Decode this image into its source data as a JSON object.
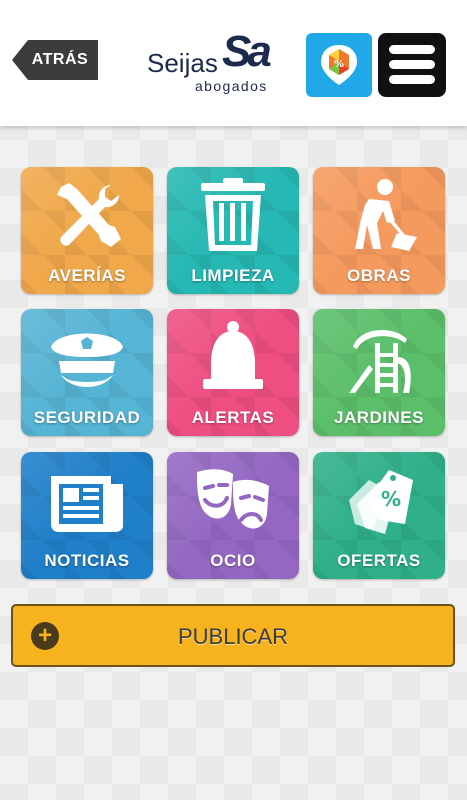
{
  "header": {
    "back_label": "ATRÁS",
    "logo": {
      "name": "Seijas",
      "mark": "Sa",
      "sub": "abogados"
    },
    "app_icon": "offers-app-icon",
    "menu_icon": "hamburger-menu-icon"
  },
  "tiles": [
    {
      "label": "AVERÍAS",
      "icon": "tools-icon",
      "color": "#f0a84a"
    },
    {
      "label": "LIMPIEZA",
      "icon": "trash-can-icon",
      "color": "#26b8b3"
    },
    {
      "label": "OBRAS",
      "icon": "construction-worker-icon",
      "color": "#f59a5e"
    },
    {
      "label": "SEGURIDAD",
      "icon": "police-cap-icon",
      "color": "#56b4d4"
    },
    {
      "label": "ALERTAS",
      "icon": "bell-icon",
      "color": "#ee4f80"
    },
    {
      "label": "JARDINES",
      "icon": "playground-icon",
      "color": "#5bbf6a"
    },
    {
      "label": "NOTICIAS",
      "icon": "newspaper-icon",
      "color": "#1f7fc9"
    },
    {
      "label": "OCIO",
      "icon": "theater-masks-icon",
      "color": "#9468c2"
    },
    {
      "label": "OFERTAS",
      "icon": "price-tags-icon",
      "color": "#2fb08a"
    }
  ],
  "publish": {
    "label": "PUBLICAR",
    "icon": "plus-icon",
    "color": "#f7b31d"
  }
}
